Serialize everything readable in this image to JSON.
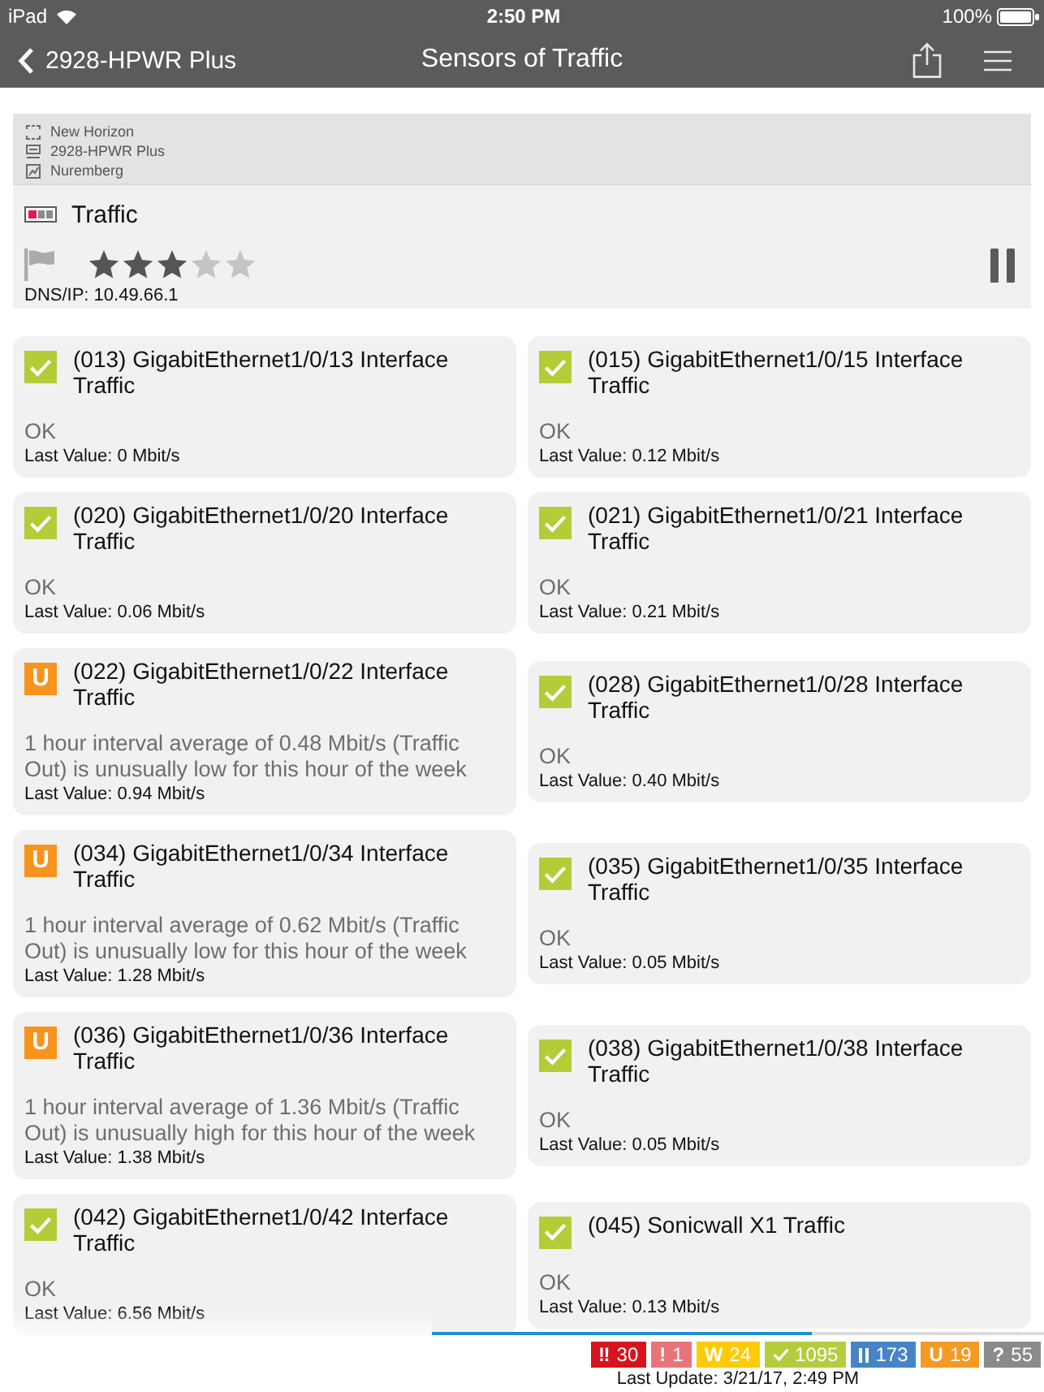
{
  "status_bar": {
    "device": "iPad",
    "time": "2:50 PM",
    "battery": "100%"
  },
  "nav_bar": {
    "back_label": "2928-HPWR Plus",
    "title": "Sensors of Traffic"
  },
  "header": {
    "breadcrumb": [
      {
        "kind": "group",
        "label": "New Horizon"
      },
      {
        "kind": "device",
        "label": "2928-HPWR Plus"
      },
      {
        "kind": "probe",
        "label": "Nuremberg"
      }
    ],
    "sensor_type": "Traffic",
    "stars": 3,
    "dns_ip": "DNS/IP: 10.49.66.1"
  },
  "sensors": [
    {
      "kind": "up",
      "color": "#b4cc38",
      "title": "(013) GigabitEthernet1/0/13 Interface Traffic",
      "message": "OK",
      "last_value": "Last Value: 0 Mbit/s"
    },
    {
      "kind": "up",
      "color": "#b4cc38",
      "title": "(015) GigabitEthernet1/0/15 Interface Traffic",
      "message": "OK",
      "last_value": "Last Value: 0.12 Mbit/s"
    },
    {
      "kind": "up",
      "color": "#b4cc38",
      "title": "(020) GigabitEthernet1/0/20 Interface Traffic",
      "message": "OK",
      "last_value": "Last Value: 0.06 Mbit/s"
    },
    {
      "kind": "up",
      "color": "#b4cc38",
      "title": "(021) GigabitEthernet1/0/21 Interface Traffic",
      "message": "OK",
      "last_value": "Last Value: 0.21 Mbit/s"
    },
    {
      "kind": "unusual",
      "symbol": "U",
      "color": "#f7941d",
      "title": "(022) GigabitEthernet1/0/22 Interface Traffic",
      "message": "1 hour interval average of 0.48 Mbit/s (Traffic Out) is unusually low for this hour of the week",
      "last_value": "Last Value: 0.94 Mbit/s"
    },
    {
      "kind": "up",
      "color": "#b4cc38",
      "title": "(028) GigabitEthernet1/0/28 Interface Traffic",
      "message": "OK",
      "last_value": "Last Value: 0.40 Mbit/s"
    },
    {
      "kind": "unusual",
      "symbol": "U",
      "color": "#f7941d",
      "title": "(034) GigabitEthernet1/0/34 Interface Traffic",
      "message": "1 hour interval average of 0.62 Mbit/s (Traffic Out) is unusually low for this hour of the week",
      "last_value": "Last Value: 1.28 Mbit/s"
    },
    {
      "kind": "up",
      "color": "#b4cc38",
      "title": "(035) GigabitEthernet1/0/35 Interface Traffic",
      "message": "OK",
      "last_value": "Last Value: 0.05 Mbit/s"
    },
    {
      "kind": "unusual",
      "symbol": "U",
      "color": "#f7941d",
      "title": "(036) GigabitEthernet1/0/36 Interface Traffic",
      "message": "1 hour interval average of 1.36 Mbit/s (Traffic Out) is unusually high for this hour of the week",
      "last_value": "Last Value: 1.38 Mbit/s"
    },
    {
      "kind": "up",
      "color": "#b4cc38",
      "title": "(038) GigabitEthernet1/0/38 Interface Traffic",
      "message": "OK",
      "last_value": "Last Value: 0.05 Mbit/s"
    },
    {
      "kind": "up",
      "color": "#b4cc38",
      "title": "(042) GigabitEthernet1/0/42 Interface Traffic",
      "message": "OK",
      "last_value": "Last Value: 6.56 Mbit/s"
    },
    {
      "kind": "up",
      "color": "#b4cc38",
      "title": "(045) Sonicwall X1 Traffic",
      "message": "OK",
      "last_value": "Last Value: 0.13 Mbit/s"
    }
  ],
  "footer": {
    "progress": {
      "level": 0.62
    },
    "counters": [
      {
        "kind": "down",
        "symbol": "‼",
        "count": "30",
        "color": "#d7141e"
      },
      {
        "kind": "down_acknowledged",
        "symbol": "!",
        "count": "1",
        "color": "#e8747a"
      },
      {
        "kind": "warning",
        "symbol": "W",
        "count": "24",
        "color": "#ffcb05"
      },
      {
        "kind": "up",
        "count": "1095",
        "color": "#b5cc3e"
      },
      {
        "kind": "paused",
        "count": "173",
        "color": "#4684c8"
      },
      {
        "kind": "unusual",
        "symbol": "U",
        "count": "19",
        "color": "#f59a23"
      },
      {
        "kind": "unknown",
        "symbol": "?",
        "count": "55",
        "color": "#8a8a8a"
      }
    ],
    "last_update": "Last Update: 3/21/17, 2:49 PM"
  }
}
